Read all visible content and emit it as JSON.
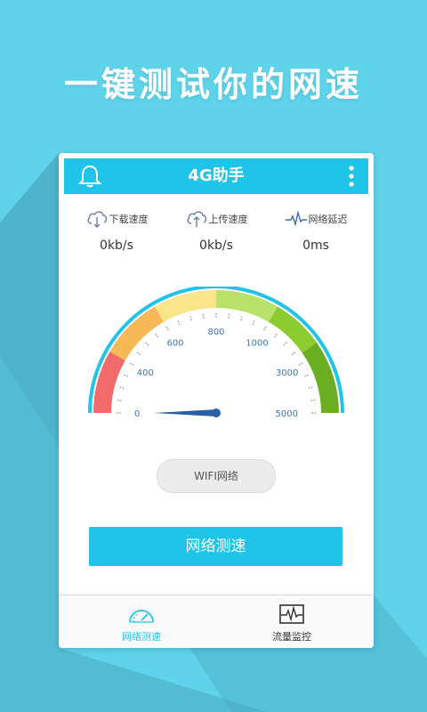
{
  "headline": "一键测试你的网速",
  "appbar": {
    "title": "4G助手"
  },
  "stats": [
    {
      "label": "下载速度",
      "value": "0kb/s",
      "icon": "cloud-download-icon"
    },
    {
      "label": "上传速度",
      "value": "0kb/s",
      "icon": "cloud-upload-icon"
    },
    {
      "label": "网络延迟",
      "value": "0ms",
      "icon": "pulse-icon"
    }
  ],
  "gauge": {
    "value": 0,
    "ticks": [
      "0",
      "400",
      "600",
      "800",
      "1000",
      "3000",
      "5000"
    ]
  },
  "network_type": "WIFI网络",
  "test_button": "网络测速",
  "tabs": [
    {
      "label": "网络测速",
      "icon": "speedometer-icon",
      "active": true
    },
    {
      "label": "流量监控",
      "icon": "monitor-wave-icon",
      "active": false
    }
  ],
  "colors": {
    "background": "#5fd3ea",
    "accent": "#20c4e8",
    "gauge_tick_text": "#3b76b8",
    "zone_red": "#f16b6b",
    "zone_orange": "#f7b955",
    "zone_yellow": "#fbe58a",
    "zone_lightgreen": "#b8e26a",
    "zone_green": "#8ccc2e",
    "zone_darkgreen": "#6cae22"
  }
}
